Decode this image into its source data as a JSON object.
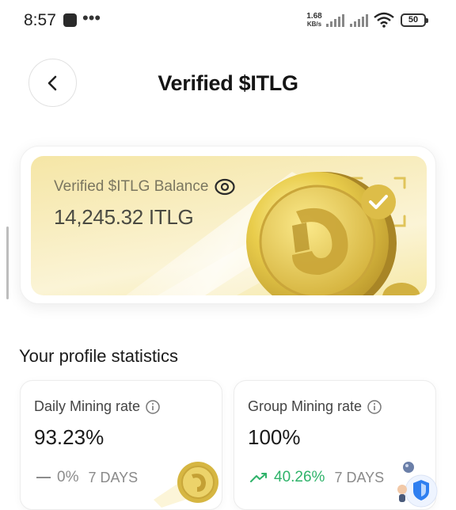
{
  "status_bar": {
    "time": "8:57",
    "speed_value": "1.68",
    "speed_unit": "KB/s",
    "battery": "50"
  },
  "header": {
    "title": "Verified $ITLG"
  },
  "balance": {
    "label": "Verified $ITLG Balance",
    "value": "14,245.32 ITLG"
  },
  "stats": {
    "title": "Your profile statistics",
    "cards": [
      {
        "label": "Daily Mining rate",
        "value": "93.23%",
        "change": "0%",
        "period": "7 DAYS",
        "trend": "flat"
      },
      {
        "label": "Group Mining rate",
        "value": "100%",
        "change": "40.26%",
        "period": "7 DAYS",
        "trend": "up"
      }
    ]
  },
  "colors": {
    "accent_gold": "#e8c84a",
    "trend_up": "#2fb36a",
    "trend_flat": "#8c8c8c"
  },
  "icons": [
    "back-chevron-icon",
    "eye-icon",
    "info-icon",
    "trend-up-icon",
    "dash-icon",
    "wifi-icon",
    "signal-icon",
    "battery-icon"
  ]
}
